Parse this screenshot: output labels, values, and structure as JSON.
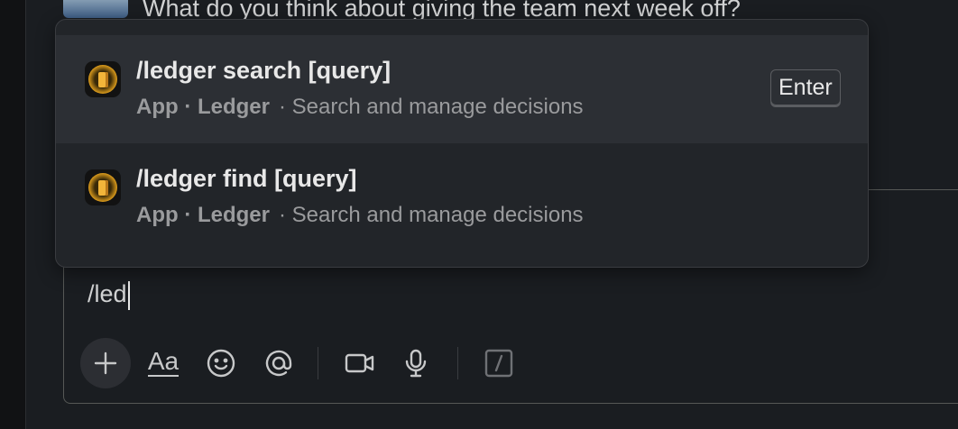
{
  "background_message": {
    "text": "What do you think about giving the team next week off?"
  },
  "composer": {
    "input_value": "/led",
    "toolbar": {
      "plus_icon": "plus-icon",
      "format_label": "Aa",
      "emoji_icon": "emoji-icon",
      "mention_icon": "at-icon",
      "video_icon": "video-icon",
      "audio_icon": "microphone-icon",
      "shortcuts_icon": "slash-icon"
    }
  },
  "suggestions": [
    {
      "command": "/ledger search [query]",
      "app_label": "App · Ledger",
      "description": "· Search and manage decisions",
      "hint": "Enter",
      "selected": true,
      "icon": "ledger-app-icon"
    },
    {
      "command": "/ledger find [query]",
      "app_label": "App · Ledger",
      "description": "· Search and manage decisions",
      "selected": false,
      "icon": "ledger-app-icon"
    }
  ],
  "colors": {
    "background": "#1a1d21",
    "popup": "#222529",
    "selected_row": "#2c2f34",
    "text_primary": "#e8e8e8",
    "text_secondary": "#9a9b9d",
    "app_icon_gold": "#d99a1c"
  }
}
